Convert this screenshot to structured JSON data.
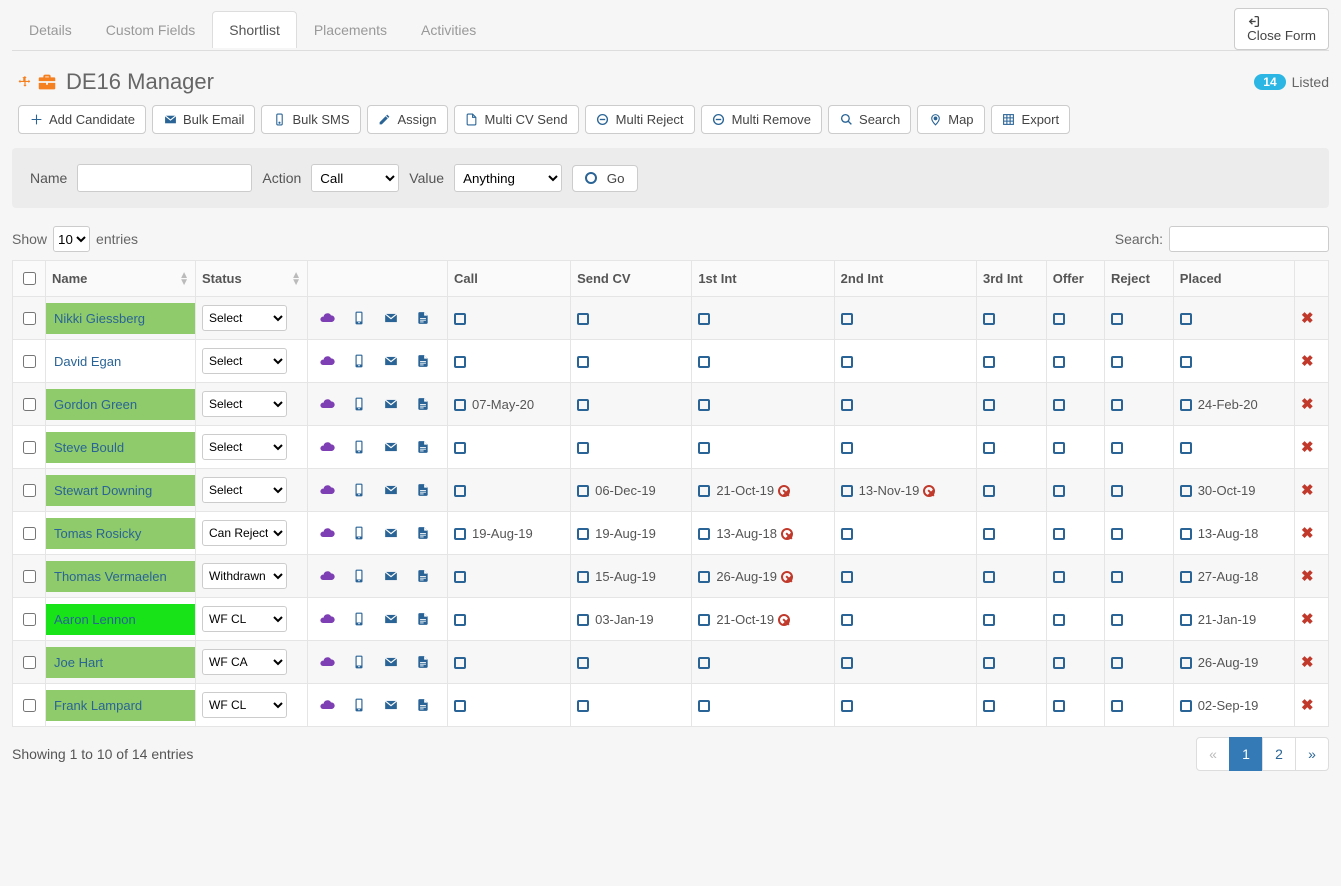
{
  "tabs": [
    "Details",
    "Custom Fields",
    "Shortlist",
    "Placements",
    "Activities"
  ],
  "active_tab_index": 2,
  "close_form": "Close Form",
  "header": {
    "title": "DE16 Manager",
    "listed_count": "14",
    "listed_label": "Listed"
  },
  "toolbar": [
    {
      "label": "Add Candidate",
      "icon": "plus",
      "color": "#2a6496"
    },
    {
      "label": "Bulk Email",
      "icon": "mail",
      "color": "#2a6496"
    },
    {
      "label": "Bulk SMS",
      "icon": "mobile",
      "color": "#2a6496"
    },
    {
      "label": "Assign",
      "icon": "pencil",
      "color": "#2a6496"
    },
    {
      "label": "Multi CV Send",
      "icon": "file",
      "color": "#2a6496"
    },
    {
      "label": "Multi Reject",
      "icon": "minus-circle",
      "color": "#2a6496"
    },
    {
      "label": "Multi Remove",
      "icon": "minus-circle",
      "color": "#2a6496"
    },
    {
      "label": "Search",
      "icon": "search",
      "color": "#2a6496"
    },
    {
      "label": "Map",
      "icon": "pin",
      "color": "#2a6496"
    },
    {
      "label": "Export",
      "icon": "grid",
      "color": "#2a6496"
    }
  ],
  "filter": {
    "name_label": "Name",
    "action_label": "Action",
    "action_value": "Call",
    "value_label": "Value",
    "value_value": "Anything",
    "go": "Go"
  },
  "entries": {
    "show": "Show",
    "count": "10",
    "entries": "entries",
    "search_label": "Search:"
  },
  "columns": [
    "",
    "Name",
    "Status",
    "",
    "Call",
    "Send CV",
    "1st Int",
    "2nd Int",
    "3rd Int",
    "Offer",
    "Reject",
    "Placed",
    ""
  ],
  "rows": [
    {
      "name": "Nikki Giessberg",
      "bg": "bg-green",
      "status": "Select",
      "call": "",
      "sendcv": "",
      "int1": "",
      "int1x": false,
      "int2": "",
      "int2x": false,
      "int3": "",
      "offer": "",
      "reject": "",
      "placed": ""
    },
    {
      "name": "David Egan",
      "bg": "bg-white",
      "status": "Select",
      "call": "",
      "sendcv": "",
      "int1": "",
      "int1x": false,
      "int2": "",
      "int2x": false,
      "int3": "",
      "offer": "",
      "reject": "",
      "placed": ""
    },
    {
      "name": "Gordon Green",
      "bg": "bg-green",
      "status": "Select",
      "call": "07-May-20",
      "sendcv": "",
      "int1": "",
      "int1x": false,
      "int2": "",
      "int2x": false,
      "int3": "",
      "offer": "",
      "reject": "",
      "placed": "24-Feb-20"
    },
    {
      "name": "Steve Bould",
      "bg": "bg-green",
      "status": "Select",
      "call": "",
      "sendcv": "",
      "int1": "",
      "int1x": false,
      "int2": "",
      "int2x": false,
      "int3": "",
      "offer": "",
      "reject": "",
      "placed": ""
    },
    {
      "name": "Stewart Downing",
      "bg": "bg-green",
      "status": "Select",
      "call": "",
      "sendcv": "06-Dec-19",
      "int1": "21-Oct-19",
      "int1x": true,
      "int2": "13-Nov-19",
      "int2x": true,
      "int3": "",
      "offer": "",
      "reject": "",
      "placed": "30-Oct-19"
    },
    {
      "name": "Tomas Rosicky",
      "bg": "bg-green",
      "status": "Can Reject",
      "call": "19-Aug-19",
      "sendcv": "19-Aug-19",
      "int1": "13-Aug-18",
      "int1x": true,
      "int2": "",
      "int2x": false,
      "int3": "",
      "offer": "",
      "reject": "",
      "placed": "13-Aug-18"
    },
    {
      "name": "Thomas Vermaelen",
      "bg": "bg-green",
      "status": "Withdrawn",
      "call": "",
      "sendcv": "15-Aug-19",
      "int1": "26-Aug-19",
      "int1x": true,
      "int2": "",
      "int2x": false,
      "int3": "",
      "offer": "",
      "reject": "",
      "placed": "27-Aug-18"
    },
    {
      "name": "Aaron Lennon",
      "bg": "bg-bright",
      "status": "WF CL",
      "call": "",
      "sendcv": "03-Jan-19",
      "int1": "21-Oct-19",
      "int1x": true,
      "int2": "",
      "int2x": false,
      "int3": "",
      "offer": "",
      "reject": "",
      "placed": "21-Jan-19"
    },
    {
      "name": "Joe Hart",
      "bg": "bg-green",
      "status": "WF CA",
      "call": "",
      "sendcv": "",
      "int1": "",
      "int1x": false,
      "int2": "",
      "int2x": false,
      "int3": "",
      "offer": "",
      "reject": "",
      "placed": "26-Aug-19"
    },
    {
      "name": "Frank Lampard",
      "bg": "bg-green",
      "status": "WF CL",
      "call": "",
      "sendcv": "",
      "int1": "",
      "int1x": false,
      "int2": "",
      "int2x": false,
      "int3": "",
      "offer": "",
      "reject": "",
      "placed": "02-Sep-19"
    }
  ],
  "footer": {
    "info": "Showing 1 to 10 of 14 entries",
    "pages": [
      "«",
      "1",
      "2",
      "»"
    ],
    "active_page_index": 1
  }
}
